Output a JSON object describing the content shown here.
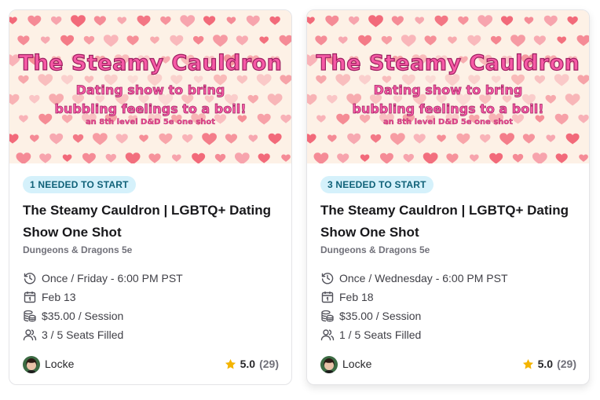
{
  "colors": {
    "badge_bg": "#d5f1fb",
    "badge_text": "#0f6178",
    "banner_pink": "#f65aa6",
    "star": "#f4b400"
  },
  "cards": [
    {
      "banner": {
        "title": "The Steamy Cauldron",
        "sub1": "Dating show to bring",
        "sub2": "bubbling feelings to a boil!",
        "tagline": "an 8th level D&D 5e one shot"
      },
      "badge": "1 NEEDED TO START",
      "title": "The Steamy Cauldron | LGBTQ+ Dating Show One Shot",
      "system": "Dungeons & Dragons 5e",
      "schedule": "Once / Friday - 6:00 PM PST",
      "date": "Feb 13",
      "price": "$35.00 / Session",
      "seats": "3 / 5 Seats Filled",
      "gm": "Locke",
      "rating": "5.0",
      "reviews": "(29)"
    },
    {
      "banner": {
        "title": "The Steamy Cauldron",
        "sub1": "Dating show to bring",
        "sub2": "bubbling feelings to a boil!",
        "tagline": "an 8th level D&D 5e one shot"
      },
      "badge": "3 NEEDED TO START",
      "title": "The Steamy Cauldron | LGBTQ+ Dating Show One Shot",
      "system": "Dungeons & Dragons 5e",
      "schedule": "Once / Wednesday - 6:00 PM PST",
      "date": "Feb 18",
      "price": "$35.00 / Session",
      "seats": "1 / 5 Seats Filled",
      "gm": "Locke",
      "rating": "5.0",
      "reviews": "(29)"
    }
  ]
}
